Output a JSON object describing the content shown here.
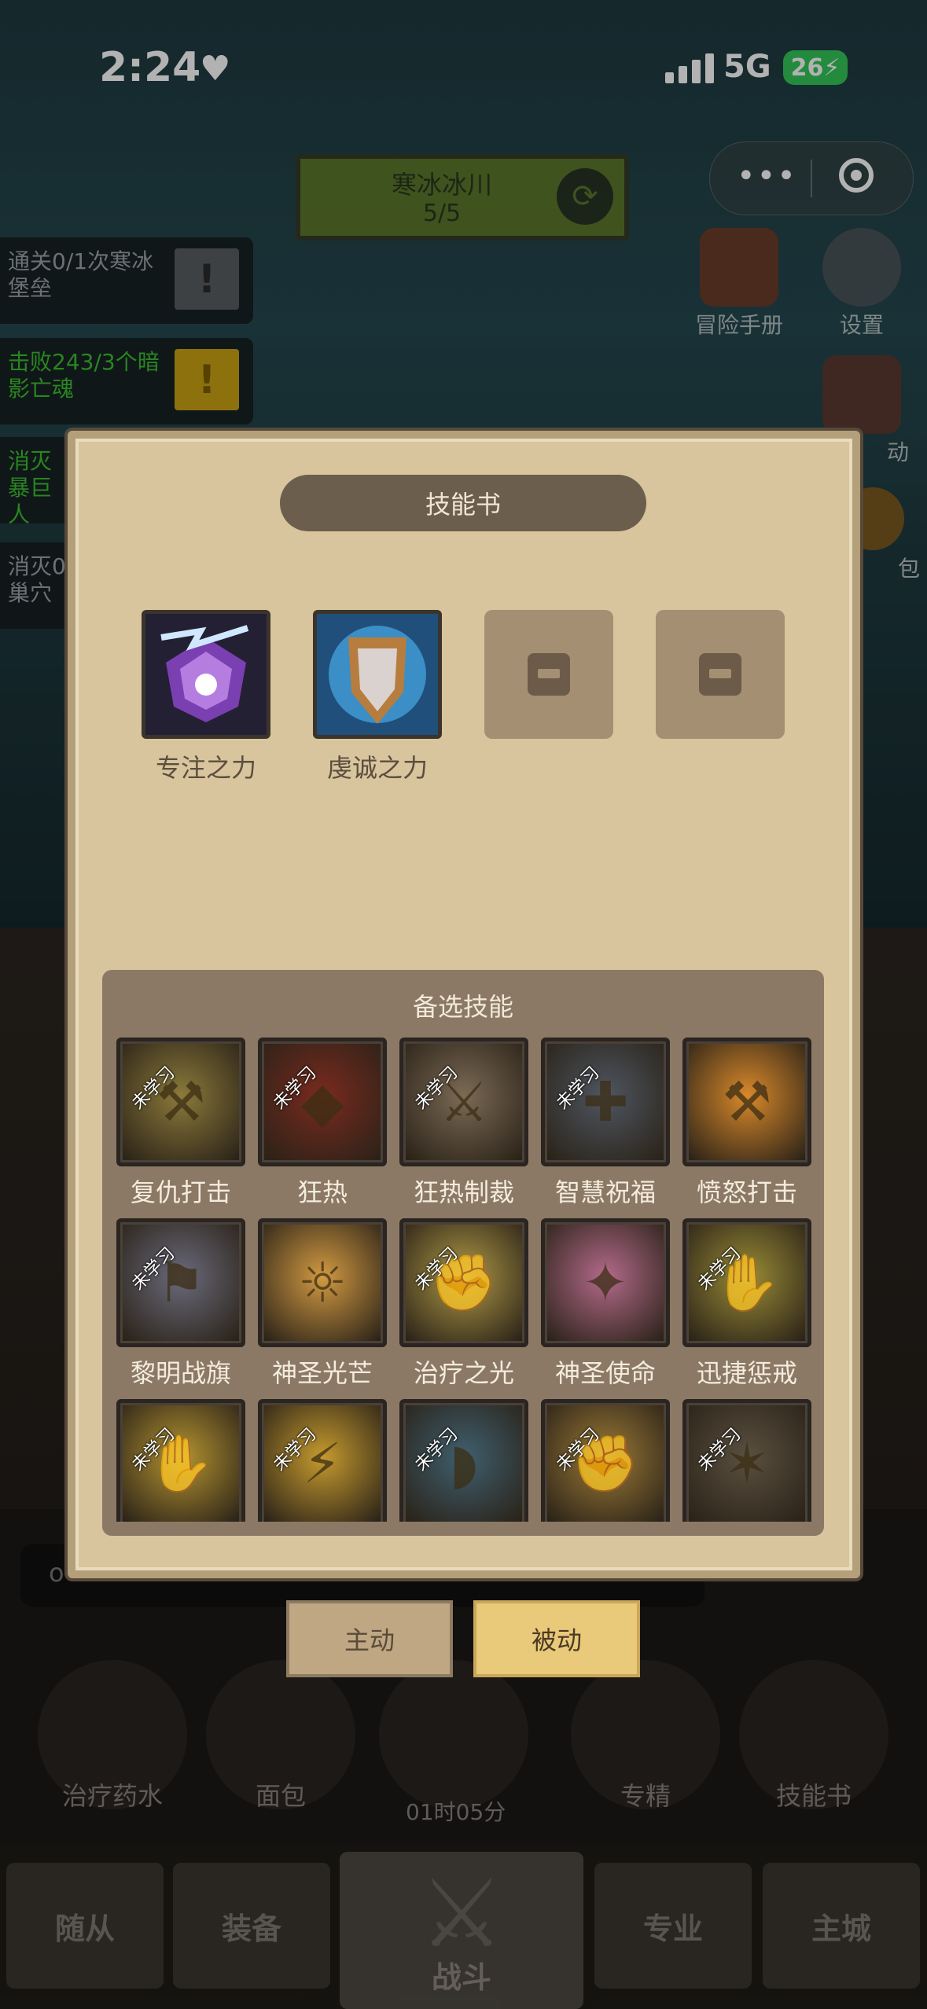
{
  "status_bar": {
    "time": "2:24",
    "network": "5G",
    "battery": "26"
  },
  "mini_program_capsule": {
    "more": "•••"
  },
  "map": {
    "name": "寒冰冰川",
    "progress": "5/5"
  },
  "quests": [
    {
      "text": "通关0/1次寒冰堡垒",
      "icon": "!"
    },
    {
      "text": "击败243/3个暗影亡魂",
      "icon": "!"
    },
    {
      "text": "消灭 暴巨人",
      "icon": ""
    },
    {
      "text": "消灭0 巢穴",
      "icon": ""
    }
  ],
  "side_icons": {
    "adventure_manual": "冒险手册",
    "settings": "设置",
    "activity": "动",
    "bag": "包"
  },
  "dialog": {
    "title": "技能书",
    "equipped": [
      {
        "name": "专注之力",
        "icon": "focus-power-icon"
      },
      {
        "name": "虔诚之力",
        "icon": "devotion-power-icon"
      },
      {
        "name": "",
        "icon": "lock-icon"
      },
      {
        "name": "",
        "icon": "lock-icon"
      }
    ],
    "candidate_title": "备选技能",
    "not_learned": "未学习",
    "candidates": [
      {
        "name": "复仇打击",
        "learned": false,
        "color": "#8b7a3a",
        "glyph": "⚒"
      },
      {
        "name": "狂热",
        "learned": false,
        "color": "#7a2a1e",
        "glyph": "◆"
      },
      {
        "name": "狂热制裁",
        "learned": false,
        "color": "#7b6a55",
        "glyph": "⚔"
      },
      {
        "name": "智慧祝福",
        "learned": false,
        "color": "#4e5660",
        "glyph": "✚"
      },
      {
        "name": "愤怒打击",
        "learned": true,
        "color": "#d9892a",
        "glyph": "⚒"
      },
      {
        "name": "黎明战旗",
        "learned": false,
        "color": "#6a6a7a",
        "glyph": "⚑"
      },
      {
        "name": "神圣光芒",
        "learned": true,
        "color": "#d29a42",
        "glyph": "☼"
      },
      {
        "name": "治疗之光",
        "learned": false,
        "color": "#b09a46",
        "glyph": "✊"
      },
      {
        "name": "神圣使命",
        "learned": true,
        "color": "#b36a8a",
        "glyph": "✦"
      },
      {
        "name": "迅捷惩戒",
        "learned": false,
        "color": "#9a8c36",
        "glyph": "✋"
      },
      {
        "name": "",
        "learned": false,
        "color": "#b59431",
        "glyph": "✋"
      },
      {
        "name": "",
        "learned": false,
        "color": "#c59a2e",
        "glyph": "⚡"
      },
      {
        "name": "",
        "learned": false,
        "color": "#3f5f6e",
        "glyph": "◗"
      },
      {
        "name": "",
        "learned": false,
        "color": "#9c7a36",
        "glyph": "✊"
      },
      {
        "name": "",
        "learned": false,
        "color": "#5a5040",
        "glyph": "✶"
      }
    ]
  },
  "tabs": {
    "active": "主动",
    "passive": "被动"
  },
  "chat_input": {
    "placeholder": "o"
  },
  "items": [
    "治疗药水",
    "面包",
    "",
    "专精",
    "技能书"
  ],
  "timer": "01时05分",
  "nav": {
    "followers": "随从",
    "equipment": "装备",
    "battle": "战斗",
    "profession": "专业",
    "city": "主城"
  }
}
